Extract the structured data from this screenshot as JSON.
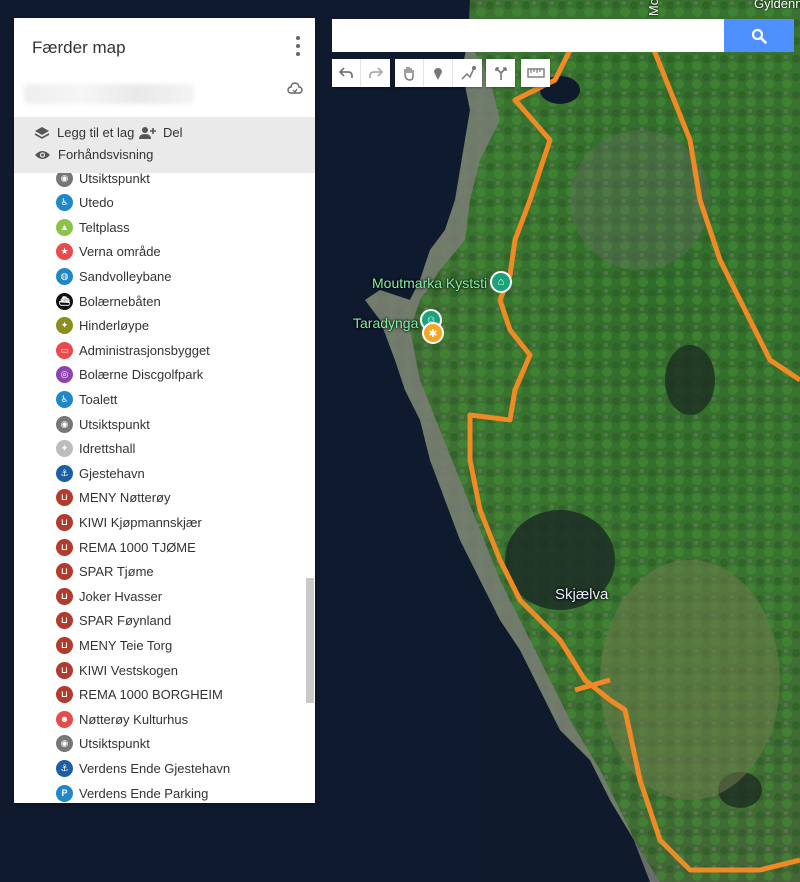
{
  "map": {
    "corner_label": "Gyldenm",
    "corner_label_2": "Mo",
    "labels": {
      "kyststi": "Moutmarka Kyststi",
      "taradynga": "Taradynga",
      "skjaelva": "Skjælva"
    },
    "route_color": "#f08a24"
  },
  "panel": {
    "title": "Færder map",
    "actions": {
      "add_layer": "Legg til et lag",
      "share": "Del",
      "preview": "Forhåndsvisning"
    }
  },
  "list": [
    {
      "label": "Utsiktspunkt",
      "color": "#777777",
      "icon": "binoculars-icon"
    },
    {
      "label": "Utedo",
      "color": "#1e88c8",
      "icon": "toilet-icon"
    },
    {
      "label": "Teltplass",
      "color": "#8bc34a",
      "icon": "tent-icon"
    },
    {
      "label": "Verna område",
      "color": "#e94b4b",
      "icon": "star-icon"
    },
    {
      "label": "Sandvolleybane",
      "color": "#1e88c8",
      "icon": "volleyball-icon"
    },
    {
      "label": "Bolærnebåten",
      "color": "#111111",
      "icon": "ferry-icon"
    },
    {
      "label": "Hinderløype",
      "color": "#8d8d1e",
      "icon": "runner-icon"
    },
    {
      "label": "Administrasjonsbygget",
      "color": "#e94b4b",
      "icon": "building-icon"
    },
    {
      "label": "Bolærne Discgolfpark",
      "color": "#8e44ad",
      "icon": "eye-icon"
    },
    {
      "label": "Toalett",
      "color": "#1e88c8",
      "icon": "toilet-icon"
    },
    {
      "label": "Utsiktspunkt",
      "color": "#777777",
      "icon": "binoculars-icon"
    },
    {
      "label": "Idrettshall",
      "color": "#bdbdbd",
      "icon": "runner-icon"
    },
    {
      "label": "Gjestehavn",
      "color": "#1b5fa6",
      "icon": "anchor-icon"
    },
    {
      "label": "MENY Nøtterøy",
      "color": "#b33a2e",
      "icon": "cart-icon"
    },
    {
      "label": "KIWI Kjøpmannskjær",
      "color": "#b33a2e",
      "icon": "cart-icon"
    },
    {
      "label": "REMA 1000 TJØME",
      "color": "#b33a2e",
      "icon": "cart-icon"
    },
    {
      "label": "SPAR Tjøme",
      "color": "#b33a2e",
      "icon": "cart-icon"
    },
    {
      "label": "Joker Hvasser",
      "color": "#b33a2e",
      "icon": "cart-icon"
    },
    {
      "label": "SPAR Føynland",
      "color": "#b33a2e",
      "icon": "cart-icon"
    },
    {
      "label": "MENY Teie Torg",
      "color": "#b33a2e",
      "icon": "cart-icon"
    },
    {
      "label": "KIWI Vestskogen",
      "color": "#b33a2e",
      "icon": "cart-icon"
    },
    {
      "label": "REMA 1000 BORGHEIM",
      "color": "#b33a2e",
      "icon": "cart-icon"
    },
    {
      "label": "Nøtterøy Kulturhus",
      "color": "#e94b4b",
      "icon": "theater-icon"
    },
    {
      "label": "Utsiktspunkt",
      "color": "#777777",
      "icon": "binoculars-icon"
    },
    {
      "label": "Verdens Ende Gjestehavn",
      "color": "#1b5fa6",
      "icon": "anchor-icon"
    },
    {
      "label": "Verdens Ende Parking",
      "color": "#1e88c8",
      "icon": "parking-icon"
    }
  ],
  "search": {
    "value": "",
    "placeholder": ""
  }
}
